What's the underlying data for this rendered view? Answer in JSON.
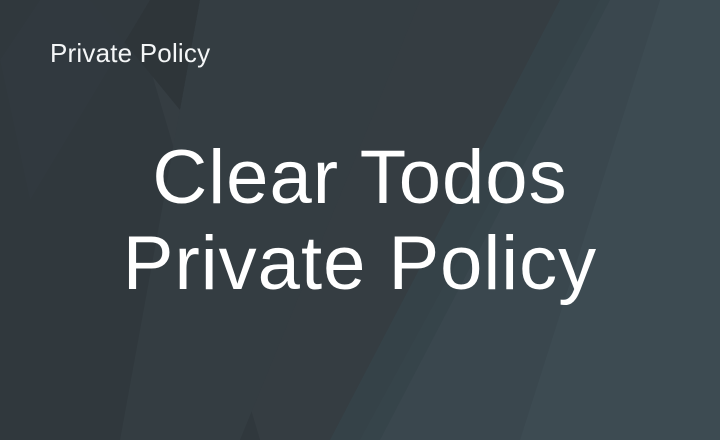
{
  "header": {
    "site_name": "Private Policy"
  },
  "hero": {
    "title_line1": "Clear Todos",
    "title_line2": "Private Policy"
  },
  "colors": {
    "background_dark": "#2f373c",
    "background_mid": "#353e43",
    "background_accent": "#3d4a51",
    "text": "#ffffff"
  }
}
